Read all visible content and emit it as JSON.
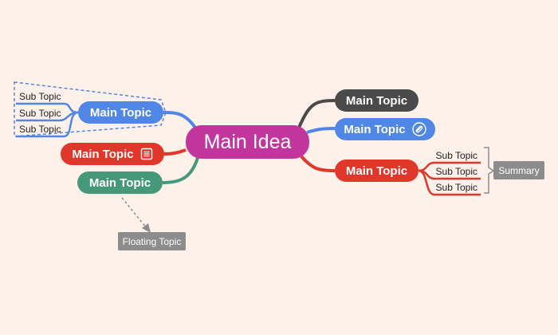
{
  "colors": {
    "background": "#fdf1ea",
    "central": "#c2359d",
    "dark": "#4a4a4a",
    "blue": "#5087e6",
    "red": "#e1362a",
    "green": "#45997a",
    "gray": "#8c8c8c"
  },
  "central": {
    "label": "Main Idea"
  },
  "topics": {
    "right_top": {
      "label": "Main Topic"
    },
    "right_blue": {
      "label": "Main Topic",
      "icon": "link-icon"
    },
    "right_red": {
      "label": "Main Topic"
    },
    "left_blue": {
      "label": "Main Topic"
    },
    "left_red": {
      "label": "Main Topic",
      "icon": "note-icon"
    },
    "left_green": {
      "label": "Main Topic"
    }
  },
  "left_subtopics": [
    "Sub Topic",
    "Sub Topic",
    "Sub Topic"
  ],
  "right_subtopics": [
    "Sub Topic",
    "Sub Topic",
    "Sub Topic"
  ],
  "summary": {
    "label": "Summary"
  },
  "floating": {
    "label": "Floating Topic"
  }
}
